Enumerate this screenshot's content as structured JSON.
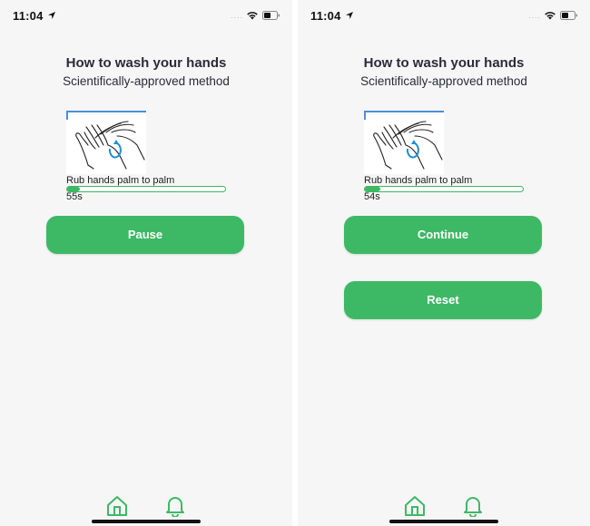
{
  "colors": {
    "accent": "#3db965",
    "frame_blue": "#4a90d9",
    "text_dark": "#2b2b3a"
  },
  "status_bar": {
    "time": "11:04",
    "signal_text": "....",
    "icons": [
      "location-arrow-icon",
      "wifi-icon",
      "battery-icon"
    ]
  },
  "screens": [
    {
      "title": "How to wash your hands",
      "subtitle": "Scientifically-approved method",
      "step_label": "Rub hands palm to palm",
      "seconds": "55s",
      "progress": 0.08,
      "primary_button": "Pause"
    },
    {
      "title": "How to wash your hands",
      "subtitle": "Scientifically-approved method",
      "step_label": "Rub hands palm to palm",
      "seconds": "54s",
      "progress": 0.1,
      "primary_button": "Continue",
      "secondary_button": "Reset"
    }
  ],
  "tab_bar": {
    "items": [
      "home-icon",
      "bell-icon"
    ]
  }
}
